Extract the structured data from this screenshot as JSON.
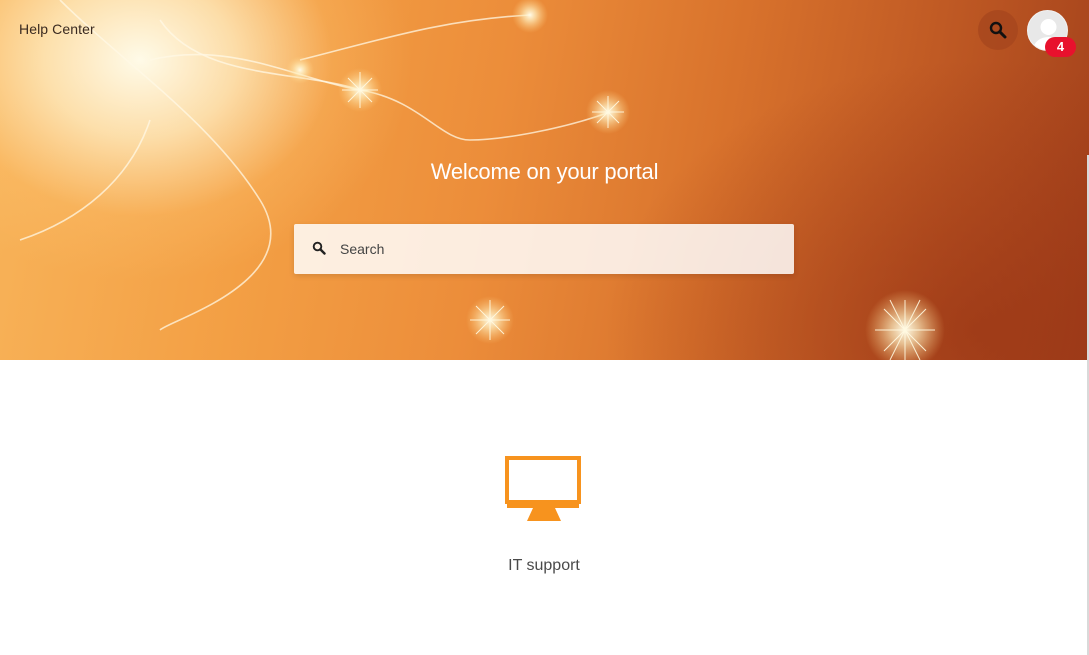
{
  "header": {
    "brand": "Help Center",
    "search_icon": "search-icon",
    "avatar_icon": "user-avatar-icon",
    "notification_count": "4"
  },
  "hero": {
    "title": "Welcome on your portal",
    "search_placeholder": "Search",
    "search_icon": "search-icon"
  },
  "categories": [
    {
      "label": "IT support",
      "icon": "monitor-icon",
      "icon_color": "#f7931e"
    }
  ],
  "colors": {
    "accent": "#f7931e",
    "badge": "#e8112d",
    "hero_orange": "#ec8d3a"
  }
}
